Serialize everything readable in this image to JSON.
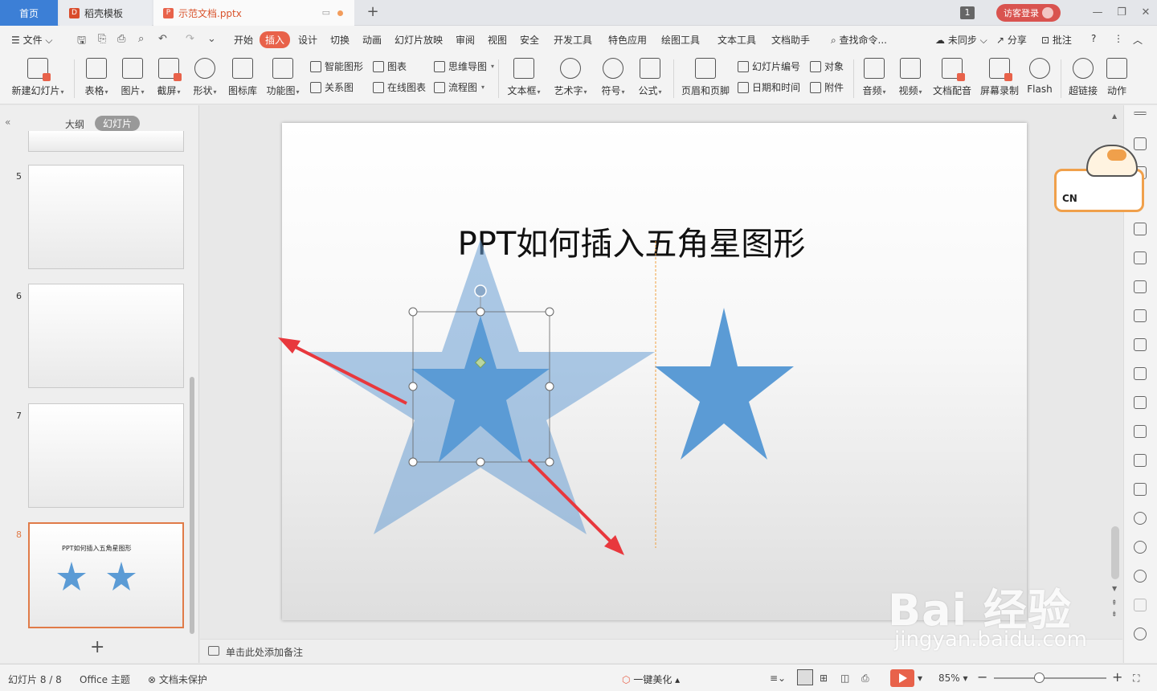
{
  "tabs": {
    "home": "首页",
    "daoke": "稻壳模板",
    "document": "示范文档.pptx",
    "window_count": "1",
    "visitor_login": "访客登录"
  },
  "menu": {
    "file": "文件",
    "items": [
      "开始",
      "插入",
      "设计",
      "切换",
      "动画",
      "幻灯片放映",
      "审阅",
      "视图",
      "安全",
      "开发工具",
      "特色应用",
      "绘图工具",
      "文本工具",
      "文档助手"
    ],
    "active": "插入",
    "search": "查找命令...",
    "sync": "未同步",
    "share": "分享",
    "comment": "批注",
    "help": "?"
  },
  "ribbon": {
    "new_slide": "新建幻灯片",
    "table": "表格",
    "picture": "图片",
    "screenshot": "截屏",
    "shape": "形状",
    "icon_lib": "图标库",
    "function_chart": "功能图",
    "smart_shape": "智能图形",
    "chart": "图表",
    "mind_map": "思维导图",
    "relation_chart": "关系图",
    "online_chart": "在线图表",
    "flowchart": "流程图",
    "textbox": "文本框",
    "art_text": "艺术字",
    "symbol": "符号",
    "formula": "公式",
    "header_footer": "页眉和页脚",
    "slide_number": "幻灯片编号",
    "object": "对象",
    "date_time": "日期和时间",
    "attachment": "附件",
    "audio": "音频",
    "video": "视频",
    "doc_dubbing": "文档配音",
    "screen_record": "屏幕录制",
    "flash": "Flash",
    "hyperlink": "超链接",
    "action": "动作"
  },
  "left_panel": {
    "outline": "大纲",
    "slides": "幻灯片",
    "thumbnails": [
      {
        "num": "5"
      },
      {
        "num": "6"
      },
      {
        "num": "7"
      },
      {
        "num": "8",
        "title": "PPT如何插入五角星图形",
        "selected": true
      }
    ]
  },
  "slide": {
    "title": "PPT如何插入五角星图形",
    "colors": {
      "star_fill": "#5b9bd5",
      "star_fill_transparent": "#6a9fd4",
      "arrow": "#e8383d",
      "guide": "#f0a040"
    }
  },
  "notes": {
    "placeholder": "单击此处添加备注"
  },
  "status": {
    "slide_info": "幻灯片 8 / 8",
    "theme": "Office 主题",
    "protect": "文档未保护",
    "beautify": "一键美化",
    "zoom": "85%"
  },
  "mascot": {
    "lang": "CN"
  },
  "watermark": {
    "text": "Bai 经验",
    "url": "jingyan.baidu.com"
  }
}
